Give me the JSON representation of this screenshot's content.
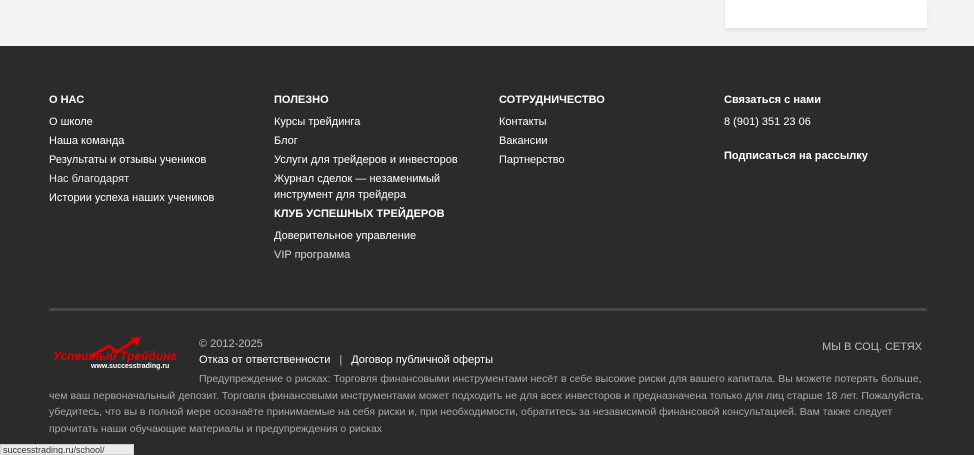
{
  "footer": {
    "about": {
      "heading": "О НАС",
      "items": [
        "О школе",
        "Наша команда",
        "Результаты и отзывы учеников",
        "Нас благодарят",
        "Истории успеха наших учеников"
      ]
    },
    "useful": {
      "heading": "ПОЛЕЗНО",
      "items": [
        "Курсы трейдинга",
        "Блог",
        "Услуги для трейдеров и инвесторов",
        "Журнал сделок — незаменимый",
        "инструмент для трейдера"
      ],
      "club_heading": "КЛУБ УСПЕШНЫХ ТРЕЙДЕРОВ",
      "club_items": [
        "Доверительное управление",
        "VIP программа"
      ]
    },
    "partners": {
      "heading": "СОТРУДНИЧЕСТВО",
      "items": [
        "Контакты",
        "Вакансии",
        "Партнерство"
      ]
    },
    "contact": {
      "heading": "Связаться с нами",
      "phone": "8 (901) 351 23 06",
      "subscribe": "Подписаться на рассылку"
    }
  },
  "bottom": {
    "logo_text": "Успешный Трейдинг",
    "logo_url": "www.successtrading.ru",
    "copyright": "© 2012-2025",
    "disclaimer_link": "Отказ от ответственности",
    "separator": "|",
    "offer_link": "Договор публичной оферты",
    "social_label": "МЫ В СОЦ. СЕТЯХ",
    "warning": "Предупреждение о рисках: Торговля финансовыми инструментами несёт в себе высокие риски для вашего капитала. Вы можете потерять больше, чем ваш первоначальный депозит. Торговля финансовыми инструментами может подходить не для всех инвесторов и предназначена только для лиц старше 18 лет. Пожалуйста, убедитесь, что вы в полной мере осознаёте принимаемые на себя риски и, при необходимости, обратитесь за независимой финансовой консультацией. Вам также следует прочитать наши обучающие материалы и предупреждения о рисках"
  },
  "status_bar": {
    "url": "successtrading.ru/school/"
  },
  "colors": {
    "footer_bg": "#2b2b2b",
    "top_bg": "#f4f4f4",
    "logo_red": "#e00000",
    "muted_text": "#a9a9a9"
  }
}
